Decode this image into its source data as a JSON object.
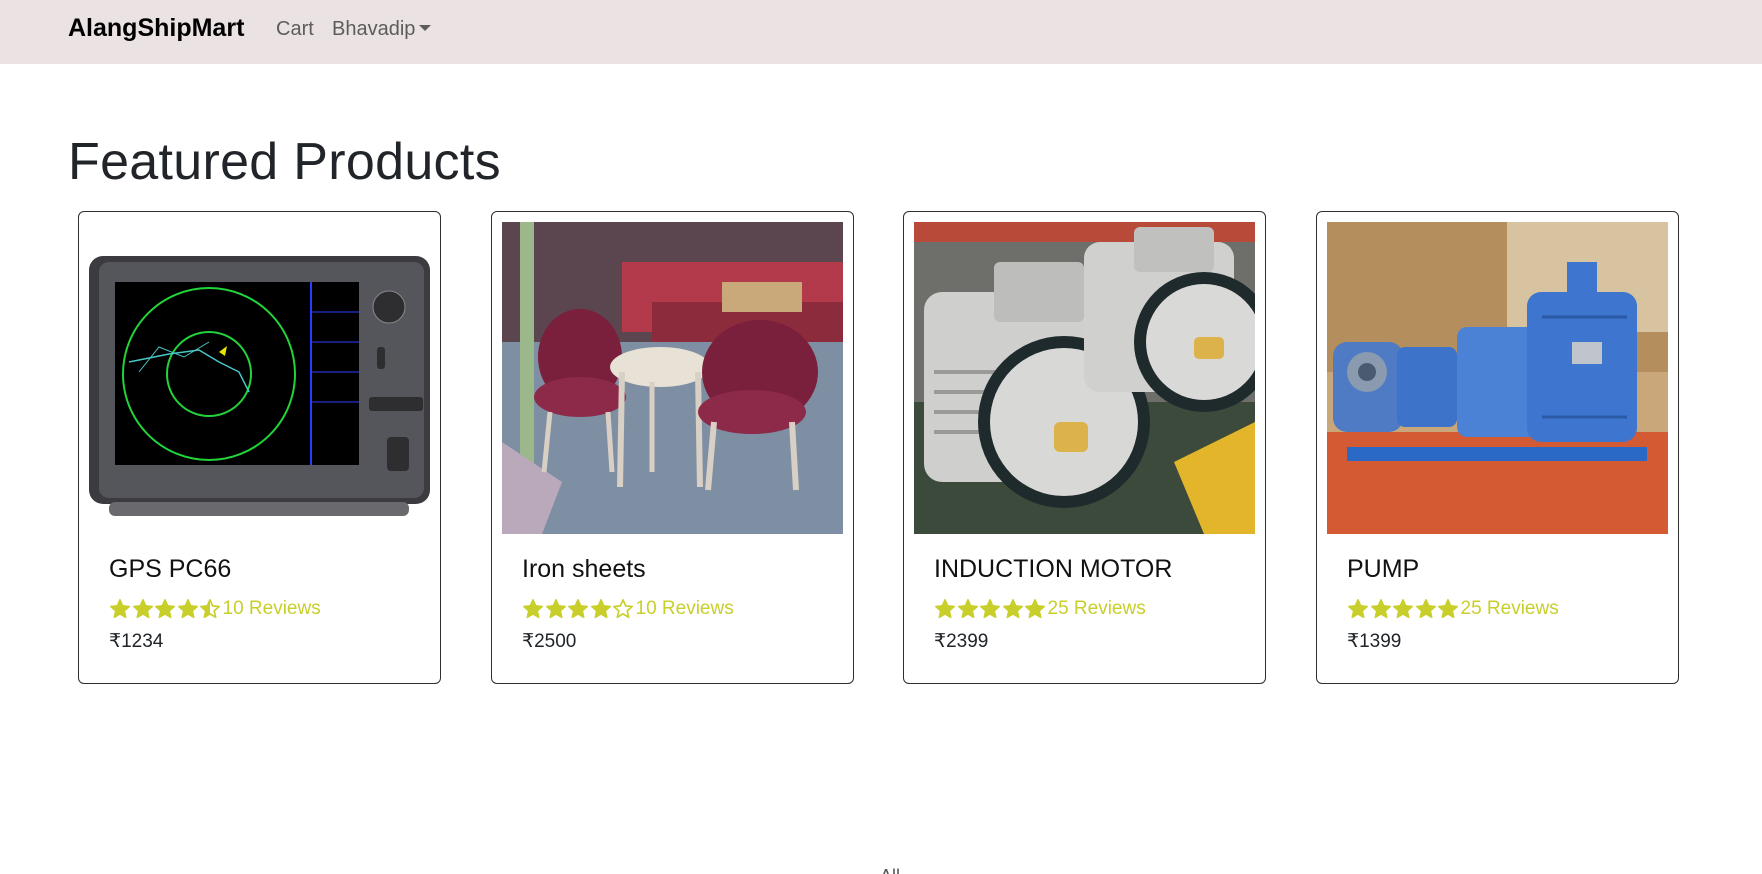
{
  "nav": {
    "brand": "AlangShipMart",
    "cart_label": "Cart",
    "user_label": "Bhavadip"
  },
  "main": {
    "heading": "Featured Products"
  },
  "products": [
    {
      "name": "GPS PC66",
      "rating": 4.5,
      "reviews": "10 Reviews",
      "price": "₹1234",
      "image": "gps-device-image"
    },
    {
      "name": "Iron sheets",
      "rating": 4,
      "reviews": "10 Reviews",
      "price": "₹2500",
      "image": "furniture-image"
    },
    {
      "name": "INDUCTION MOTOR",
      "rating": 5,
      "reviews": "25 Reviews",
      "price": "₹2399",
      "image": "induction-motor-image"
    },
    {
      "name": "PUMP",
      "rating": 5,
      "reviews": "25 Reviews",
      "price": "₹1399",
      "image": "pump-image"
    }
  ],
  "colors": {
    "navbar_bg": "#ebe3e3",
    "star": "#c8cf2a",
    "reviews": "#c8cf2a"
  },
  "footer": {
    "partial_text": "All"
  }
}
